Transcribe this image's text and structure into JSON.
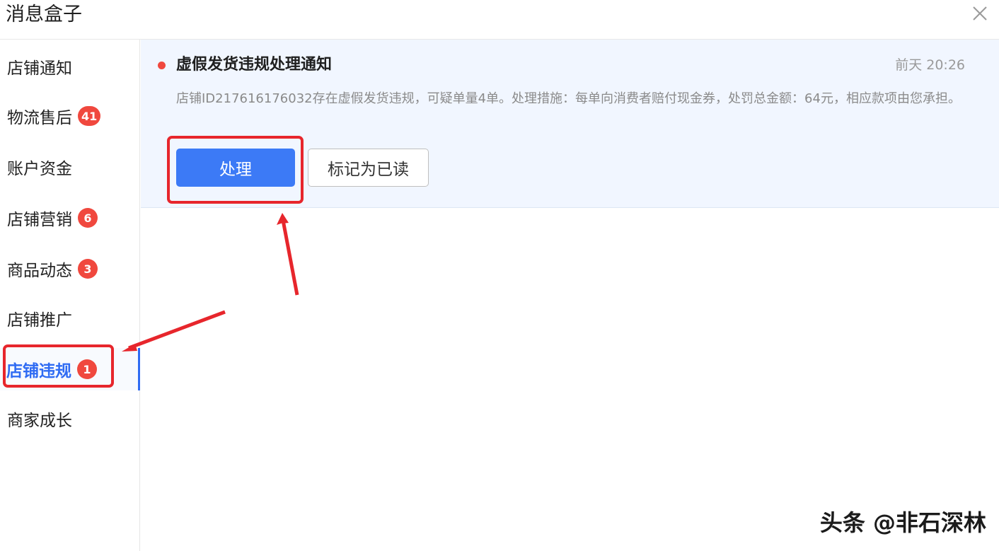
{
  "dialog": {
    "title": "消息盒子"
  },
  "sidebar": {
    "items": [
      {
        "label": "店铺通知",
        "badge": ""
      },
      {
        "label": "物流售后",
        "badge": "41"
      },
      {
        "label": "账户资金",
        "badge": ""
      },
      {
        "label": "店铺营销",
        "badge": "6"
      },
      {
        "label": "商品动态",
        "badge": "3"
      },
      {
        "label": "店铺推广",
        "badge": ""
      },
      {
        "label": "店铺违规",
        "badge": "1"
      },
      {
        "label": "商家成长",
        "badge": ""
      }
    ],
    "active_label": "店铺违规"
  },
  "message": {
    "title": "虚假发货违规处理通知",
    "time": "前天 20:26",
    "body": "店铺ID217616176032存在虚假发货违规，可疑单量4单。处理措施：每单向消费者赔付现金券，处罚总金额：64元，相应款项由您承担。",
    "primary_action": "处理",
    "secondary_action": "标记为已读"
  },
  "watermark": {
    "text": "头条 @非石深林"
  },
  "colors": {
    "accent": "#2f6bf3",
    "primary_button": "#3c7af6",
    "badge": "#f0483e",
    "annotation": "#e7262c",
    "card_background": "#f1f6ff"
  },
  "icons": {
    "close": "close-icon",
    "unread": "unread-dot-icon"
  }
}
